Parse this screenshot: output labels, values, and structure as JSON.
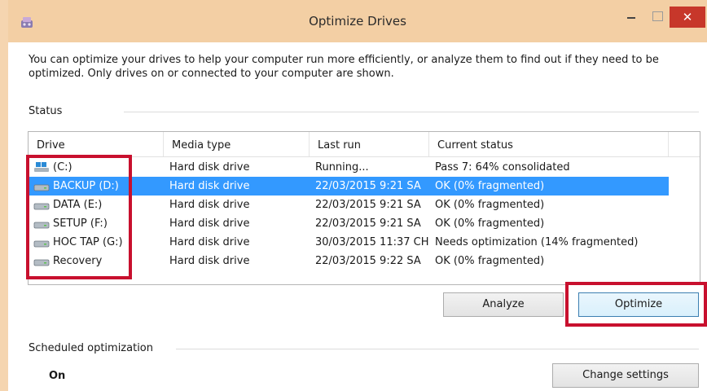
{
  "window": {
    "title": "Optimize Drives",
    "close_glyph": "✕"
  },
  "description": "You can optimize your drives to help your computer run more efficiently, or analyze them to find out if they need to be optimized. Only drives on or connected to your computer are shown.",
  "status": {
    "heading": "Status",
    "columns": [
      "Drive",
      "Media type",
      "Last run",
      "Current status"
    ],
    "rows": [
      {
        "drive": "(C:)",
        "icon": "system-drive-icon",
        "media": "Hard disk drive",
        "last_run": "Running...",
        "status": "Pass 7: 64% consolidated",
        "selected": false
      },
      {
        "drive": "BACKUP (D:)",
        "icon": "drive-icon",
        "media": "Hard disk drive",
        "last_run": "22/03/2015 9:21 SA",
        "status": "OK (0% fragmented)",
        "selected": true
      },
      {
        "drive": "DATA (E:)",
        "icon": "drive-icon",
        "media": "Hard disk drive",
        "last_run": "22/03/2015 9:21 SA",
        "status": "OK (0% fragmented)",
        "selected": false
      },
      {
        "drive": "SETUP (F:)",
        "icon": "drive-icon",
        "media": "Hard disk drive",
        "last_run": "22/03/2015 9:21 SA",
        "status": "OK (0% fragmented)",
        "selected": false
      },
      {
        "drive": "HOC TAP (G:)",
        "icon": "drive-icon",
        "media": "Hard disk drive",
        "last_run": "30/03/2015 11:37 CH",
        "status": "Needs optimization (14% fragmented)",
        "selected": false
      },
      {
        "drive": "Recovery",
        "icon": "drive-icon",
        "media": "Hard disk drive",
        "last_run": "22/03/2015 9:22 SA",
        "status": "OK (0% fragmented)",
        "selected": false
      }
    ]
  },
  "buttons": {
    "analyze": "Analyze",
    "optimize": "Optimize",
    "change_settings": "Change settings"
  },
  "scheduled": {
    "heading": "Scheduled optimization",
    "state": "On"
  },
  "colors": {
    "titlebar": "#f3cfa4",
    "selection": "#3399ff",
    "highlight_box": "#c8102e",
    "close_button": "#c7372a"
  }
}
